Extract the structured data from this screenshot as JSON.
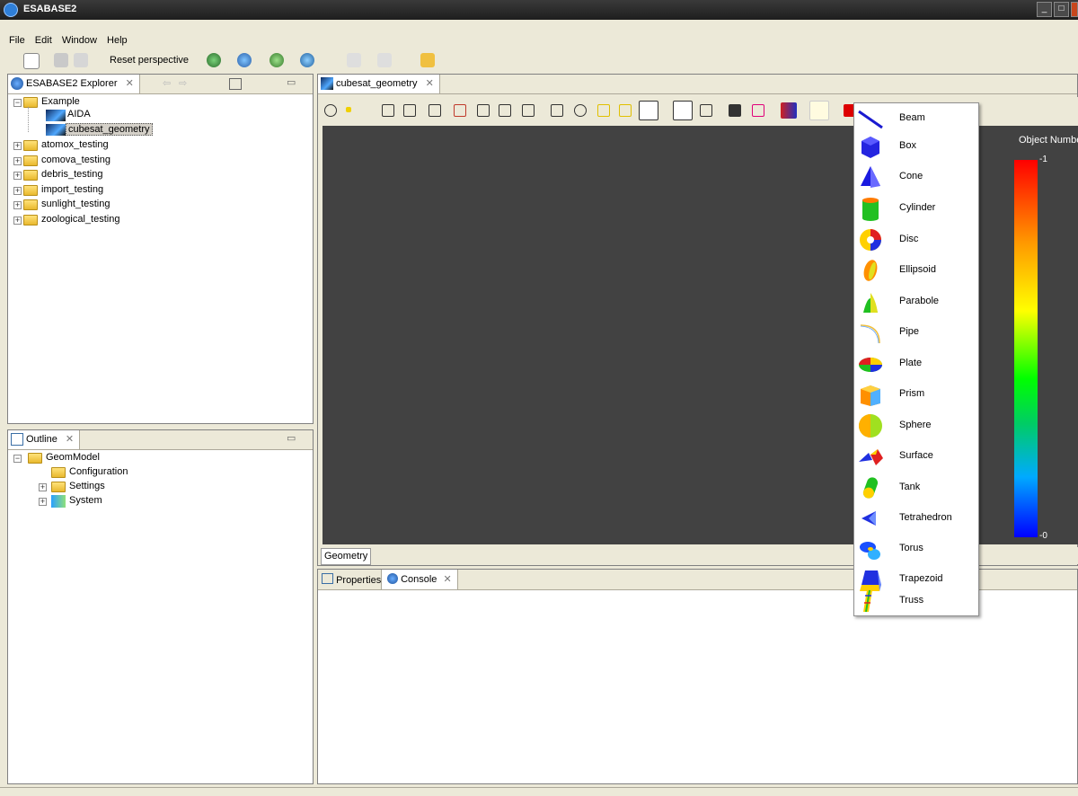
{
  "window": {
    "title": "ESABASE2"
  },
  "menu": [
    "File",
    "Edit",
    "Window",
    "Help"
  ],
  "toolbar": {
    "reset_label": "Reset perspective"
  },
  "explorer": {
    "tab": "ESABASE2 Explorer",
    "root": "Example",
    "children": [
      "AIDA",
      "cubesat_geometry"
    ],
    "projects": [
      "atomox_testing",
      "comova_testing",
      "debris_testing",
      "import_testing",
      "sunlight_testing",
      "zoological_testing"
    ]
  },
  "outline": {
    "tab": "Outline",
    "root": "GeomModel",
    "children": [
      "Configuration",
      "Settings",
      "System"
    ]
  },
  "editor": {
    "tab": "cubesat_geometry",
    "bottom_tab": "Geometry",
    "legend_title": "Object Number",
    "legend_max": "-1",
    "legend_min": "-0"
  },
  "bottom_panel": {
    "tabs": [
      "Properties",
      "Console"
    ]
  },
  "shapes_menu": [
    "Beam",
    "Box",
    "Cone",
    "Cylinder",
    "Disc",
    "Ellipsoid",
    "Parabole",
    "Pipe",
    "Plate",
    "Prism",
    "Sphere",
    "Surface",
    "Tank",
    "Tetrahedron",
    "Torus",
    "Trapezoid",
    "Truss"
  ]
}
